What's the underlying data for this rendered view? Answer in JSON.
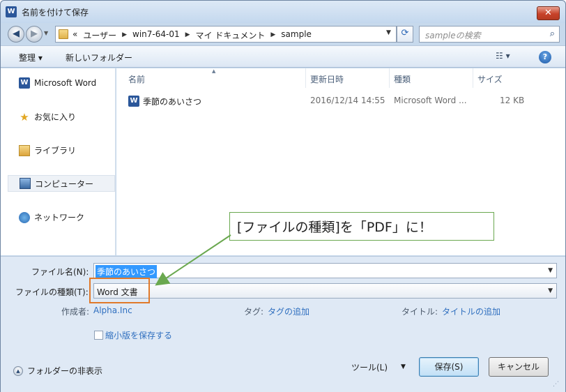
{
  "window": {
    "title": "名前を付けて保存",
    "app_icon": "W",
    "close_label": "✕"
  },
  "nav": {
    "back_icon": "back-arrow-icon",
    "forward_icon": "forward-arrow-icon",
    "crumbs": [
      "«",
      "ユーザー",
      "win7-64-01",
      "マイ ドキュメント",
      "sample"
    ],
    "search_placeholder": "sampleの検索"
  },
  "toolbar": {
    "organize": "整理 ▾",
    "new_folder": "新しいフォルダー",
    "view": "☷ ▾",
    "help": "?"
  },
  "sidebar": {
    "items": [
      {
        "label": "Microsoft Word",
        "icon": "word-icon"
      },
      {
        "label": "お気に入り",
        "icon": "star-icon"
      },
      {
        "label": "ライブラリ",
        "icon": "library-icon"
      },
      {
        "label": "コンピューター",
        "icon": "computer-icon"
      },
      {
        "label": "ネットワーク",
        "icon": "network-icon"
      }
    ]
  },
  "files": {
    "columns": [
      "名前",
      "更新日時",
      "種類",
      "サイズ"
    ],
    "rows": [
      {
        "name": "季節のあいさつ",
        "date": "2016/12/14 14:55",
        "type": "Microsoft Word ...",
        "size": "12 KB"
      }
    ]
  },
  "callout": {
    "text": "[ファイルの種類]を「PDF」に！",
    "color": "#6aa84f"
  },
  "form": {
    "filename_label": "ファイル名(N):",
    "filename_value": "季節のあいさつ",
    "filetype_label": "ファイルの種類(T):",
    "filetype_value": "Word 文書",
    "author_label": "作成者:",
    "author_value": "Alpha.Inc",
    "tag_label": "タグ:",
    "tag_value": "タグの追加",
    "title_label": "タイトル:",
    "title_value": "タイトルの追加",
    "thumbnail_label": "縮小版を保存する",
    "hide_folders": "フォルダーの非表示",
    "tools": "ツール(L)",
    "save": "保存(S)",
    "cancel": "キャンセル"
  }
}
